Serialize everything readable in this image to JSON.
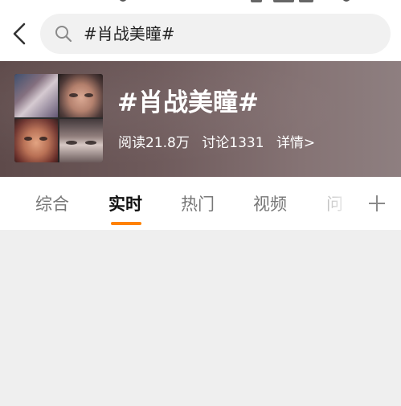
{
  "search": {
    "query": "#肖战美瞳#",
    "icon": "search-icon"
  },
  "nav": {
    "back_icon": "chevron-left-icon"
  },
  "topic": {
    "title": "#肖战美瞳#",
    "reads": "阅读21.8万",
    "discussions": "讨论1331",
    "details": "详情>"
  },
  "tabs": [
    {
      "label": "综合",
      "active": false
    },
    {
      "label": "实时",
      "active": true
    },
    {
      "label": "热门",
      "active": false
    },
    {
      "label": "视频",
      "active": false
    },
    {
      "label": "问",
      "active": false
    }
  ],
  "colors": {
    "accent": "#ff8200",
    "page_background": "#efefef"
  }
}
